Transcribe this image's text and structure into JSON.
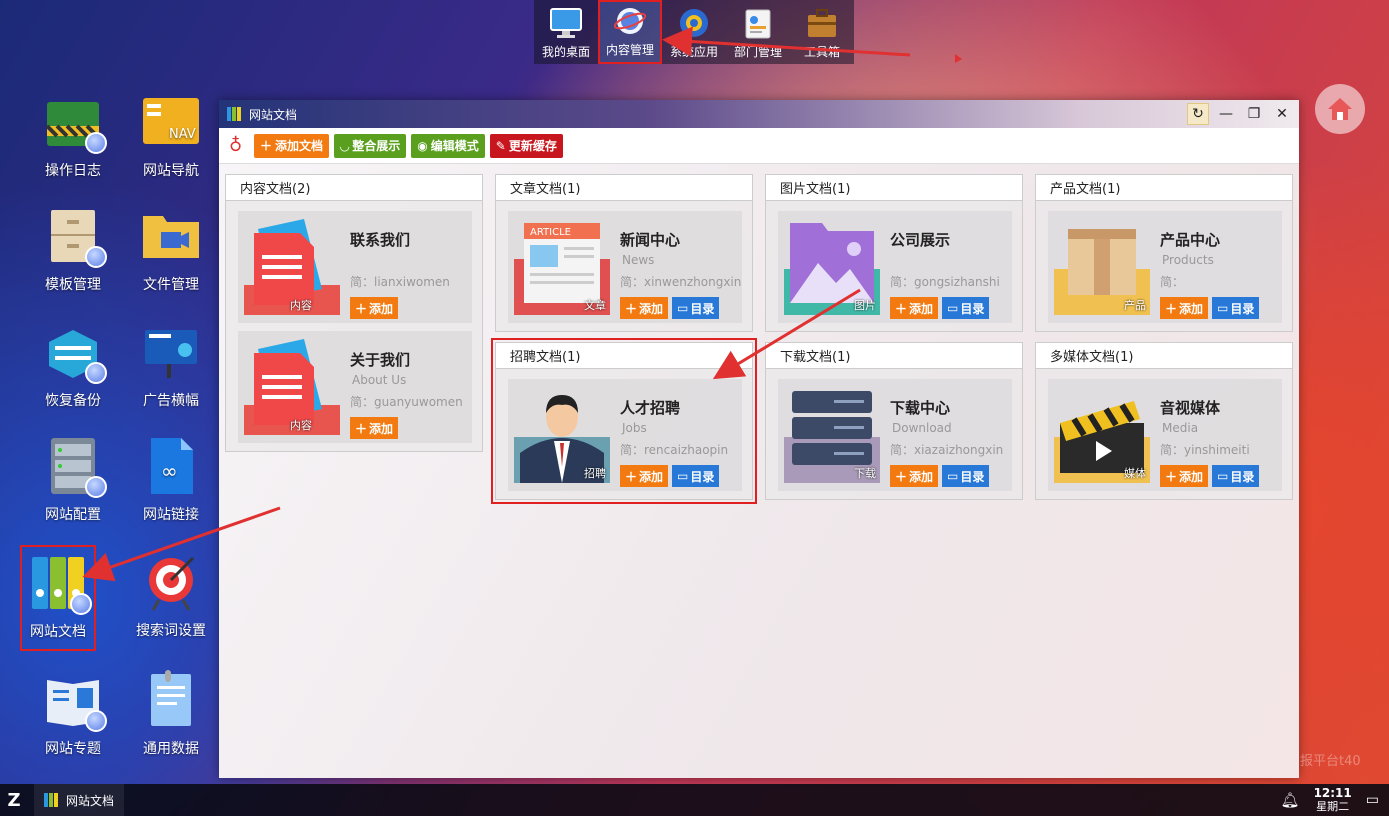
{
  "dock": {
    "items": [
      {
        "label": "我的桌面"
      },
      {
        "label": "内容管理"
      },
      {
        "label": "系统应用"
      },
      {
        "label": "部门管理"
      },
      {
        "label": "工具箱"
      }
    ]
  },
  "desktop": {
    "icons": [
      {
        "label": "操作日志"
      },
      {
        "label": "网站导航"
      },
      {
        "label": "模板管理"
      },
      {
        "label": "文件管理"
      },
      {
        "label": "恢复备份"
      },
      {
        "label": "广告横幅"
      },
      {
        "label": "网站配置"
      },
      {
        "label": "网站链接"
      },
      {
        "label": "网站文档"
      },
      {
        "label": "搜索词设置"
      },
      {
        "label": "网站专题"
      },
      {
        "label": "通用数据"
      }
    ],
    "nav_badge": "NAV"
  },
  "window": {
    "title": "网站文档",
    "toolbar": {
      "add_doc": "添加文档",
      "integrate": "整合展示",
      "edit_mode": "编辑模式",
      "refresh_cache": "更新缓存"
    },
    "panels": [
      {
        "header": "内容文档(2)",
        "cards": [
          {
            "title": "联系我们",
            "sub": "",
            "code": "简：lianxiwomen",
            "label": "内容",
            "add": "添加"
          },
          {
            "title": "关于我们",
            "sub": "About Us",
            "code": "简：guanyuwomen",
            "label": "内容",
            "add": "添加"
          }
        ]
      },
      {
        "header": "文章文档(1)",
        "cards": [
          {
            "title": "新闻中心",
            "sub": "News",
            "code": "简：xinwenzhongxin",
            "label": "文章",
            "add": "添加",
            "dir": "目录",
            "badge": "ARTICLE"
          }
        ]
      },
      {
        "header": "图片文档(1)",
        "cards": [
          {
            "title": "公司展示",
            "sub": "",
            "code": "简：gongsizhanshi",
            "label": "图片",
            "add": "添加",
            "dir": "目录"
          }
        ]
      },
      {
        "header": "产品文档(1)",
        "cards": [
          {
            "title": "产品中心",
            "sub": "Products",
            "code": "简：",
            "label": "产品",
            "add": "添加",
            "dir": "目录"
          }
        ]
      },
      {
        "header": "招聘文档(1)",
        "cards": [
          {
            "title": "人才招聘",
            "sub": "Jobs",
            "code": "简：rencaizhaopin",
            "label": "招聘",
            "add": "添加",
            "dir": "目录"
          }
        ]
      },
      {
        "header": "下载文档(1)",
        "cards": [
          {
            "title": "下载中心",
            "sub": "Download",
            "code": "简：xiazaizhongxin",
            "label": "下载",
            "add": "添加",
            "dir": "目录"
          }
        ]
      },
      {
        "header": "多媒体文档(1)",
        "cards": [
          {
            "title": "音视媒体",
            "sub": "Media",
            "code": "简：yinshimeiti",
            "label": "媒体",
            "add": "添加",
            "dir": "目录"
          }
        ]
      }
    ]
  },
  "taskbar": {
    "start": "Z",
    "task": "网站文档",
    "time": "12:11",
    "weekday": "星期二"
  },
  "watermark": "报平台t40",
  "colors": {
    "orange": "#f27a10",
    "green": "#5aa01e",
    "red": "#c8161e",
    "blue": "#2878d8",
    "highlight": "#e02020"
  }
}
